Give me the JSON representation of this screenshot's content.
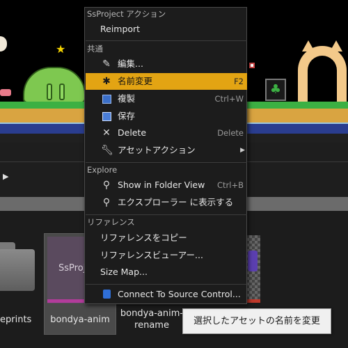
{
  "context_menu": {
    "header_ssproject": "SsProject アクション",
    "reimport": "Reimport",
    "header_common": "共通",
    "edit": "編集...",
    "rename": "名前変更",
    "rename_shortcut": "F2",
    "duplicate": "複製",
    "duplicate_shortcut": "Ctrl+W",
    "save": "保存",
    "delete": "Delete",
    "delete_shortcut": "Delete",
    "asset_actions": "アセットアクション",
    "header_explore": "Explore",
    "show_in_folder": "Show in Folder View",
    "show_in_folder_shortcut": "Ctrl+B",
    "show_in_explorer": "エクスプローラー に表示する",
    "header_reference": "リファレンス",
    "copy_reference": "リファレンスをコピー",
    "reference_viewer": "リファレンスビューアー...",
    "size_map": "Size Map...",
    "connect_source_control": "Connect To Source Control..."
  },
  "content_browser": {
    "folder_label": "eprints",
    "asset_selected_label": "bondya-anim",
    "asset_selected_thumb": "SsProj",
    "asset_rename_label_1": "bondya-anim-",
    "asset_rename_label_2": "rename"
  },
  "tooltip": {
    "text": "選択したアセットの名前を変更"
  },
  "colors": {
    "highlight": "#e3a413",
    "menu_bg": "#1c1c1c",
    "tooltip_bg": "#f0f0f0"
  },
  "icons": {
    "edit": "pencil-icon",
    "rename": "rename-sparkle-icon",
    "duplicate": "duplicate-icon",
    "save": "save-icon",
    "delete": "delete-x-icon",
    "asset_actions": "wrench-icon",
    "show_in_folder": "magnifier-icon",
    "show_in_explorer": "magnifier-icon",
    "connect_source_control": "source-control-icon"
  }
}
